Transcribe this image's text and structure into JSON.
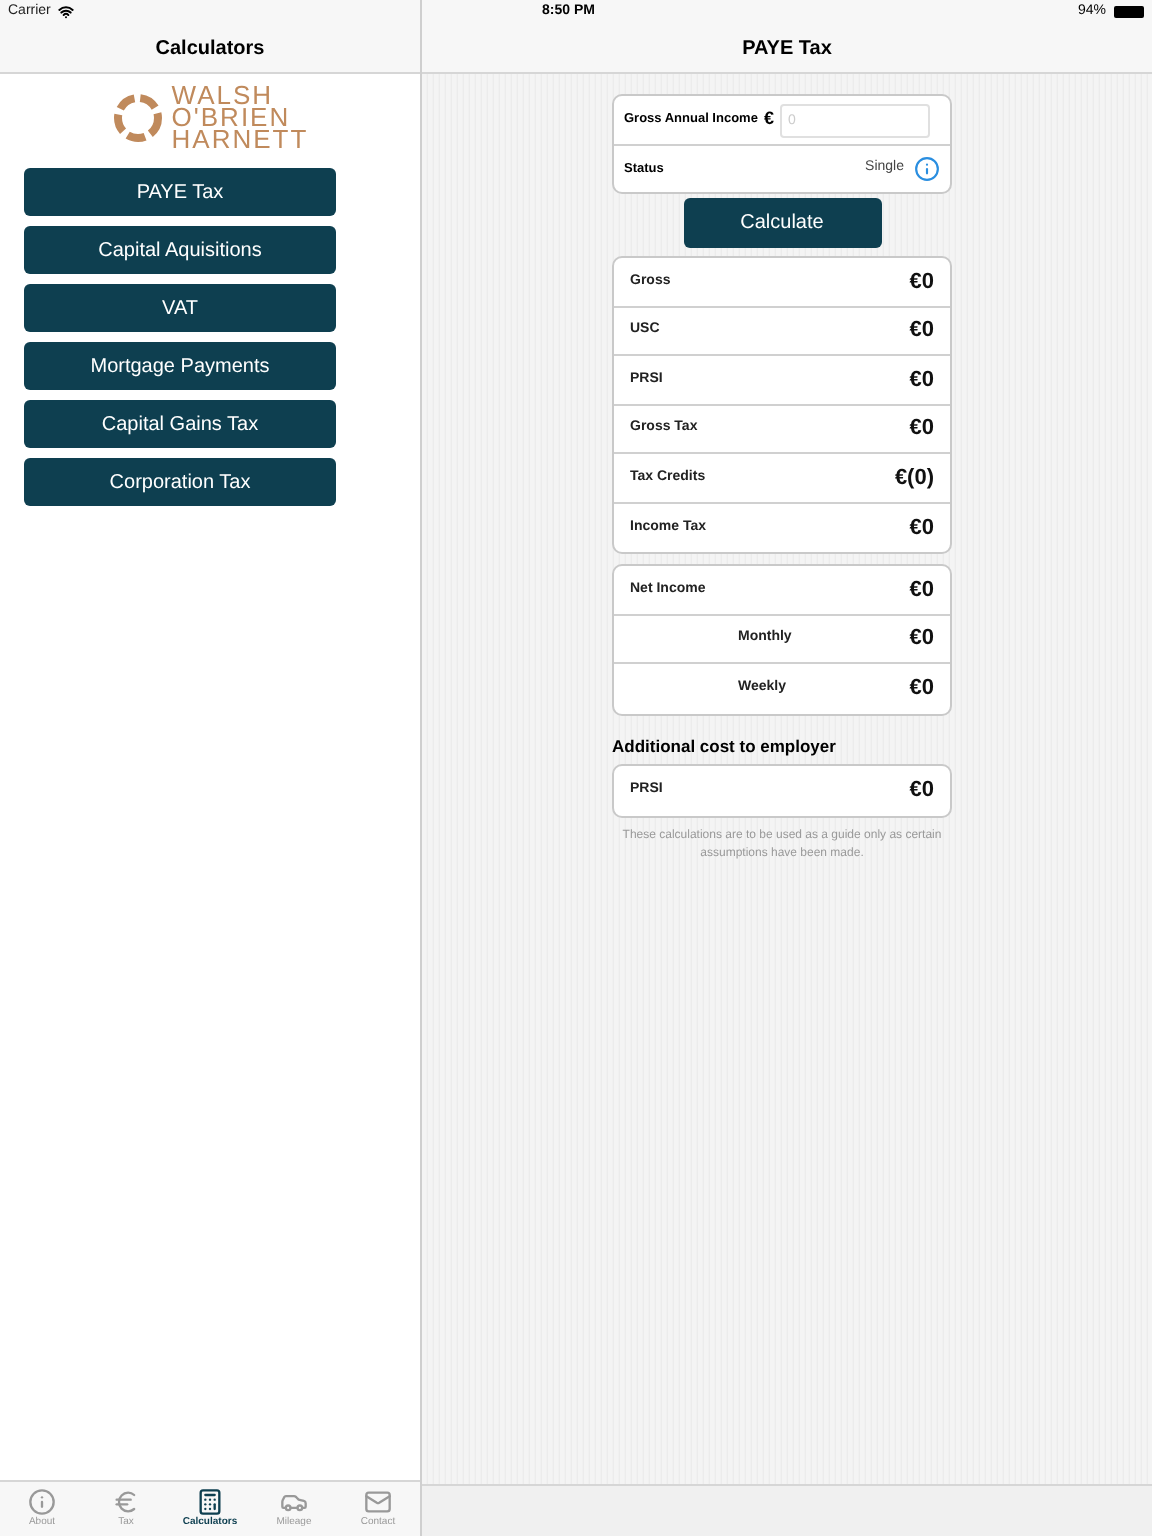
{
  "status_bar": {
    "carrier": "Carrier",
    "time": "8:50 PM",
    "battery": "94%"
  },
  "sidebar": {
    "title": "Calculators",
    "logo_lines": [
      "WALSH",
      "O'BRIEN",
      "HARNETT"
    ],
    "items": [
      {
        "label": "PAYE Tax"
      },
      {
        "label": "Capital Aquisitions"
      },
      {
        "label": "VAT"
      },
      {
        "label": "Mortgage Payments"
      },
      {
        "label": "Capital Gains Tax"
      },
      {
        "label": "Corporation Tax"
      }
    ]
  },
  "tab_bar": [
    {
      "label": "About",
      "kind": "info",
      "selected": false
    },
    {
      "label": "Tax",
      "kind": "euro",
      "selected": false
    },
    {
      "label": "Calculators",
      "kind": "calculator",
      "selected": true
    },
    {
      "label": "Mileage",
      "kind": "car",
      "selected": false
    },
    {
      "label": "Contact",
      "kind": "mail",
      "selected": false
    }
  ],
  "main": {
    "title": "PAYE Tax",
    "input": {
      "label": "Gross Annual Income",
      "currency": "€",
      "placeholder": "0"
    },
    "status": {
      "label": "Status",
      "value": "Single"
    },
    "calculate_button": "Calculate",
    "results": [
      {
        "label": "Gross",
        "value": "€0"
      },
      {
        "label": "USC",
        "value": "€0"
      },
      {
        "label": "PRSI",
        "value": "€0"
      },
      {
        "label": "Gross Tax",
        "value": "€0"
      },
      {
        "label": "Tax Credits",
        "value": "€(0)"
      },
      {
        "label": "Income Tax",
        "value": "€0"
      }
    ],
    "net": [
      {
        "label": "Net Income",
        "value": "€0",
        "indented": false
      },
      {
        "label": "Monthly",
        "value": "€0",
        "indented": true
      },
      {
        "label": "Weekly",
        "value": "€0",
        "indented": true
      }
    ],
    "employer_heading": "Additional cost to employer",
    "employer": [
      {
        "label": "PRSI",
        "value": "€0"
      }
    ],
    "note": "These calculations are to be used as a guide only as certain assumptions have been made."
  }
}
